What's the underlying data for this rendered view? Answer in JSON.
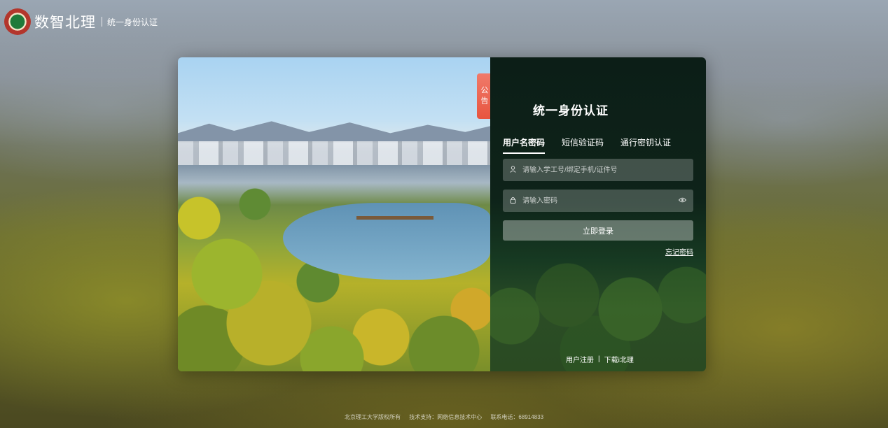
{
  "brand": {
    "logo_icon": "school-seal-logo",
    "name": "数智北理",
    "subtitle": "统一身份认证"
  },
  "notice_tab": "公告",
  "login": {
    "title": "统一身份认证",
    "tabs": [
      {
        "label": "用户名密码",
        "active": true
      },
      {
        "label": "短信验证码",
        "active": false
      },
      {
        "label": "通行密钥认证",
        "active": false
      }
    ],
    "username_placeholder": "请输入学工号/绑定手机/证件号",
    "password_placeholder": "请输入密码",
    "submit_label": "立即登录",
    "forgot_label": "忘记密码",
    "register_label": "用户注册",
    "separator": "|",
    "download_label": "下载i北理"
  },
  "footer": {
    "copyright": "北京理工大学版权所有",
    "support": "技术支持：网络信息技术中心",
    "phone": "联系电话：68914833"
  },
  "colors": {
    "panel_bg": "#0e2319",
    "notice_tab": "#e8553f"
  }
}
